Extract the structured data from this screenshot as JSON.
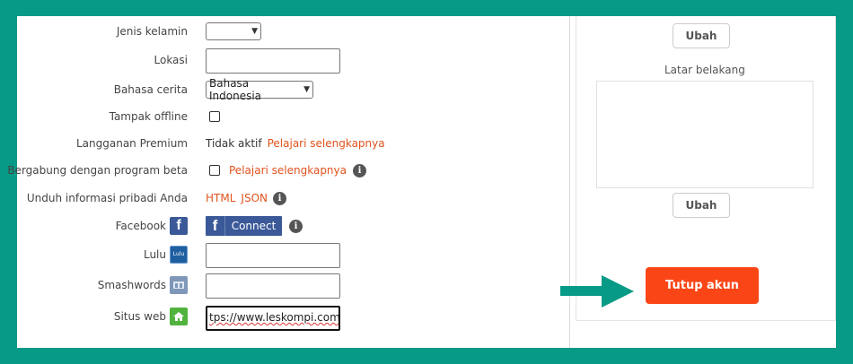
{
  "form": {
    "gender": {
      "label": "Jenis kelamin",
      "value": ""
    },
    "location": {
      "label": "Lokasi",
      "value": ""
    },
    "story_language": {
      "label": "Bahasa cerita",
      "value": "Bahasa Indonesia"
    },
    "appear_offline": {
      "label": "Tampak offline",
      "checked": false
    },
    "premium": {
      "label": "Langganan Premium",
      "status": "Tidak aktif",
      "link": "Pelajari selengkapnya"
    },
    "beta": {
      "label": "Bergabung dengan program beta",
      "checked": false,
      "link": "Pelajari selengkapnya"
    },
    "download": {
      "label": "Unduh informasi pribadi Anda",
      "html_link": "HTML",
      "json_link": "JSON"
    },
    "facebook": {
      "label": "Facebook",
      "button_icon": "f",
      "button_text": "Connect",
      "icon_letter": "f"
    },
    "lulu": {
      "label": "Lulu",
      "icon_text": "Lulu",
      "value": ""
    },
    "smashwords": {
      "label": "Smashwords",
      "value": ""
    },
    "website": {
      "label": "Situs web",
      "value": "tps://www.leskompi.com/"
    }
  },
  "right_panel": {
    "change_button_top": "Ubah",
    "background_label": "Latar belakang",
    "change_button_bottom": "Ubah",
    "close_account_button": "Tutup akun"
  },
  "info_icon_glyph": "i",
  "colors": {
    "frame": "#079a86",
    "link": "#e0531d",
    "close_button": "#fa4616",
    "facebook": "#3b5998",
    "arrow": "#079a86"
  }
}
